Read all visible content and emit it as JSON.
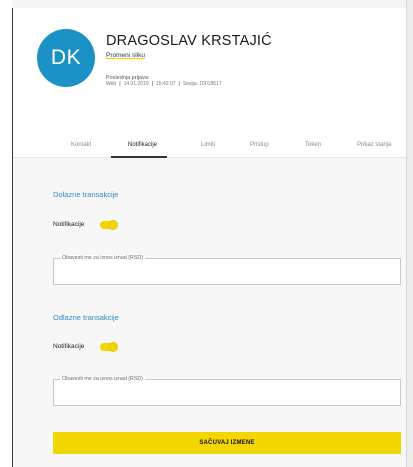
{
  "profile": {
    "initials": "DK",
    "name": "DRAGOSLAV KRSTAJIĆ",
    "change_photo_label": "Promeni sliku",
    "last_login_label": "Poslednja prijava:",
    "last_login_channel": "Web",
    "last_login_date": "14.01.2019",
    "last_login_time": "15:42:07",
    "last_login_session": "Sesija: 10018617"
  },
  "tabs": [
    {
      "label": "Kontakt",
      "active": false
    },
    {
      "label": "Notifikacije",
      "active": true
    },
    {
      "label": "Limiti",
      "active": false
    },
    {
      "label": "Pristup",
      "active": false
    },
    {
      "label": "Token",
      "active": false
    },
    {
      "label": "Prikaz stanja",
      "active": false
    }
  ],
  "incoming": {
    "title": "Dolazne transakcije",
    "notification_label": "Notifikacije",
    "toggle_on": true,
    "amount_legend": "Obavesti me za iznos iznad (RSD)",
    "amount_value": ""
  },
  "outgoing": {
    "title": "Odlazne transakcije",
    "notification_label": "Notifikacije",
    "toggle_on": true,
    "amount_legend": "Obavesti me za iznos iznad (RSD)",
    "amount_value": ""
  },
  "actions": {
    "save_label": "SAČUVAJ IZMENE"
  },
  "colors": {
    "accent_yellow": "#f2d600",
    "accent_blue": "#1b91c6",
    "section_title_blue": "#2a8cc6"
  },
  "icons": {
    "separator": "vertical-bar-separator"
  }
}
